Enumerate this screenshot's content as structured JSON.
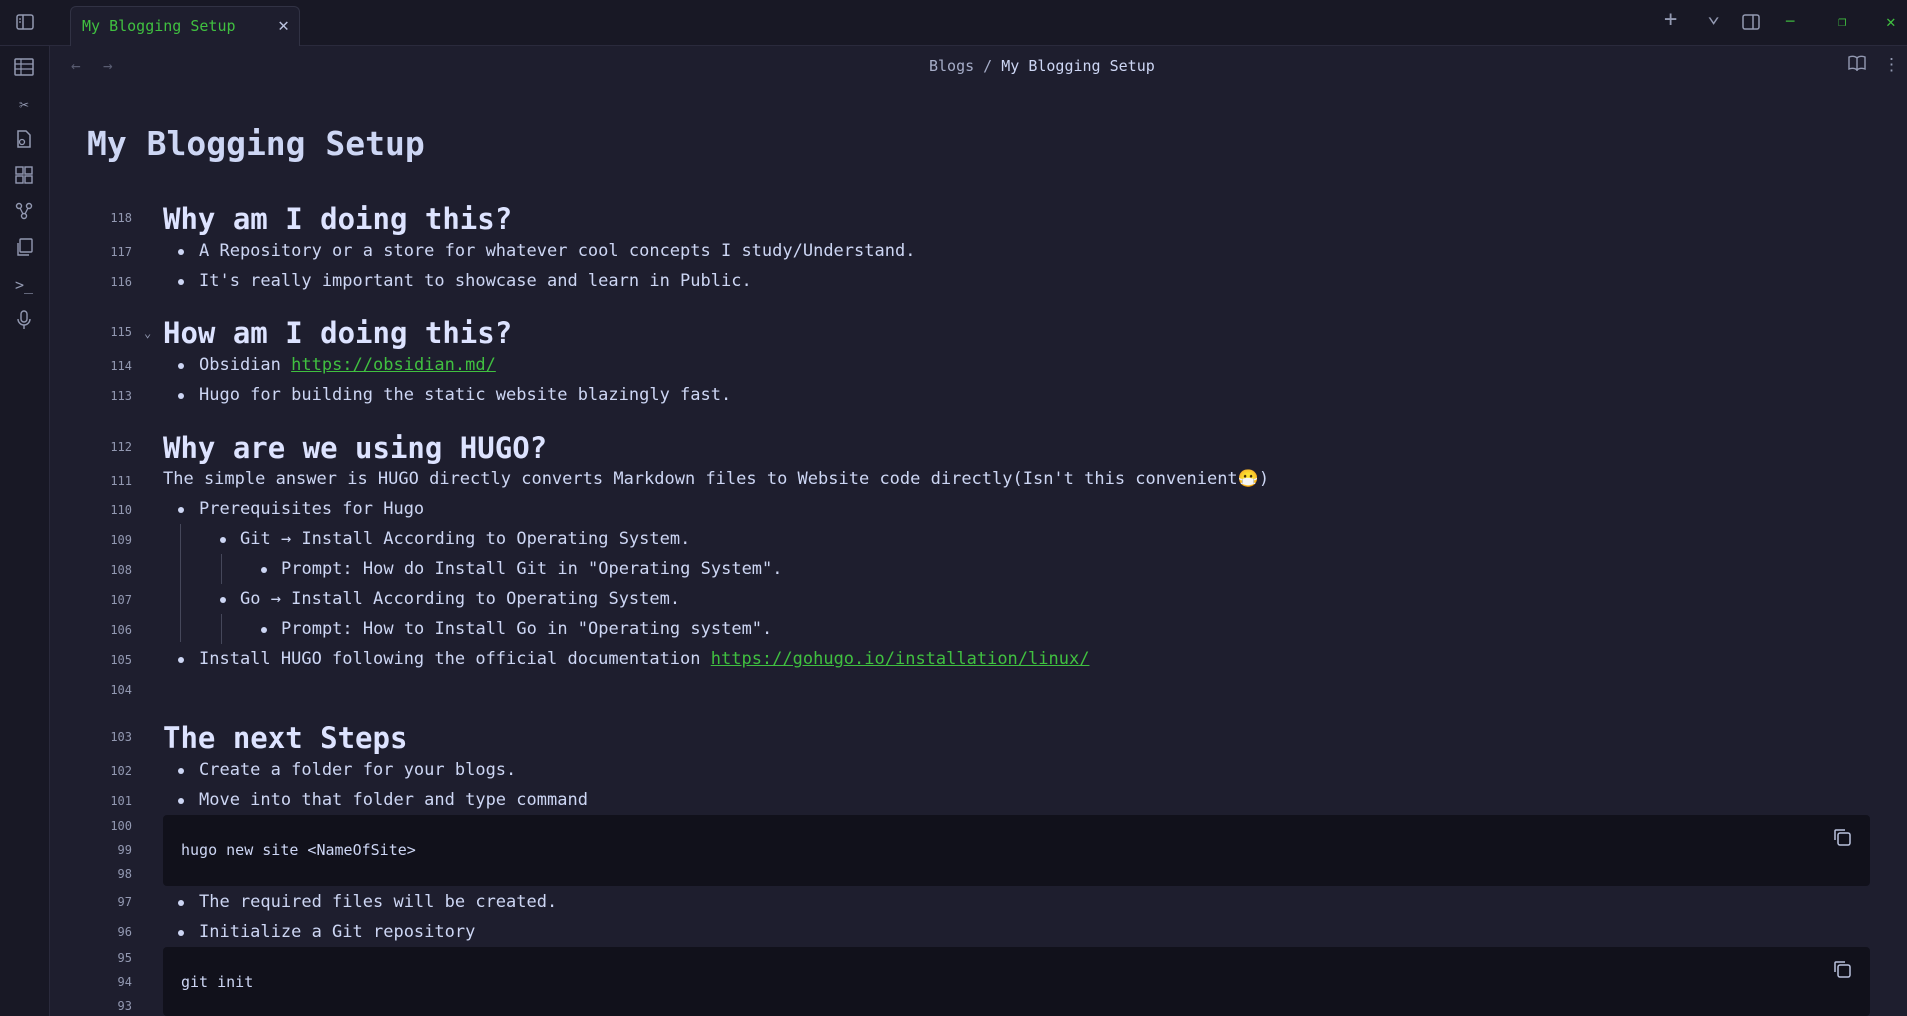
{
  "titlebar": {
    "tab_title": "My Blogging Setup",
    "tab_close": "✕",
    "new_tab": "+",
    "tab_list": "⌄",
    "minimize": "─",
    "restore": "❐",
    "close": "✕"
  },
  "ribbon": {
    "icons": [
      "table-icon",
      "wand-icon",
      "file-search-icon",
      "dashboard-icon",
      "graph-icon",
      "copy-files-icon",
      "terminal-icon",
      "microphone-icon"
    ]
  },
  "header": {
    "back": "←",
    "forward": "→",
    "breadcrumb_parent": "Blogs",
    "breadcrumb_sep": " / ",
    "breadcrumb_current": "My Blogging Setup",
    "reading_view": "📖",
    "more_options": "⋮"
  },
  "doc": {
    "title": "My Blogging Setup",
    "line_numbers": [
      "118",
      "117",
      "116",
      "115",
      "114",
      "113",
      "112",
      "111",
      "110",
      "109",
      "108",
      "107",
      "106",
      "105",
      "104",
      "103",
      "102",
      "101",
      "100",
      "99",
      "98",
      "97",
      "96",
      "95",
      "94",
      "93"
    ],
    "h_why": "Why am I doing this?",
    "why_1": "A Repository or a store for whatever cool concepts I study/Understand.",
    "why_2": "It's really important to showcase and learn in Public.",
    "h_how": "How am I doing this?",
    "how_1_text": "Obsidian ",
    "how_1_link": "https://obsidian.md/",
    "how_2": "Hugo for building the static website blazingly fast.",
    "h_hugo": "Why are we using HUGO?",
    "hugo_para": "The simple answer is HUGO directly converts Markdown files to Website code directly(Isn't this convenient😷)",
    "prereq": "Prerequisites for Hugo",
    "git": "Git → Install According to Operating System.",
    "git_prompt": "Prompt: How do Install Git in \"Operating System\".",
    "go": "Go → Install According to Operating System.",
    "go_prompt": "Prompt: How to Install Go in \"Operating system\".",
    "install_text": " Install HUGO following the official documentation ",
    "install_link": "https://gohugo.io/installation/linux/",
    "h_next": "The next Steps",
    "next_1": "Create a folder for your blogs.",
    "next_2": "Move into that folder and type command",
    "code_1": "hugo new site <NameOfSite>",
    "next_3": "The required files will be created.",
    "next_4": "Initialize a Git repository",
    "code_2": "git init"
  },
  "colors": {
    "accent": "#40c040",
    "background": "#1e1e2e",
    "chrome": "#181825",
    "code_bg": "#11111b"
  }
}
